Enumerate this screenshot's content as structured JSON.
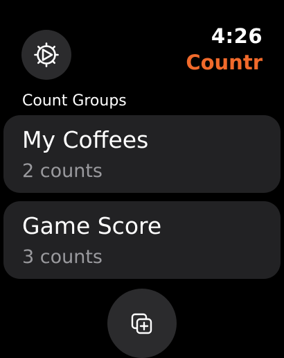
{
  "header": {
    "time": "4:26",
    "app_title": "Countr",
    "settings_icon": "gear-icon"
  },
  "section": {
    "title": "Count Groups"
  },
  "groups": [
    {
      "name": "My Coffees",
      "count_label": "2 counts"
    },
    {
      "name": "Game Score",
      "count_label": "3 counts"
    }
  ],
  "footer": {
    "add_icon": "add-group-icon"
  },
  "colors": {
    "accent": "#f16a2b",
    "card_background": "#222224",
    "button_background": "#2b2b2d",
    "secondary_text": "#9a9a9e"
  }
}
